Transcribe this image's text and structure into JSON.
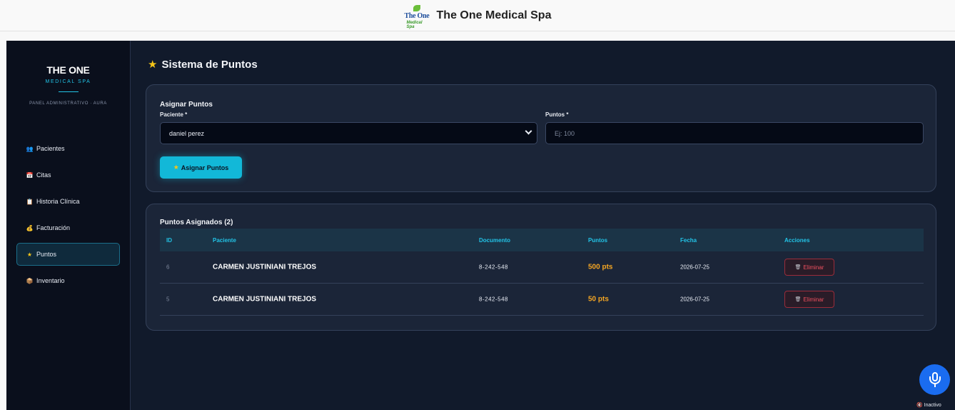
{
  "header": {
    "logo_text_top": "The One",
    "logo_text_bottom": "Medical Spa",
    "title": "The One Medical Spa"
  },
  "sidebar": {
    "brand_title": "THE ONE",
    "brand_sub": "MEDICAL SPA",
    "panel_label": "PANEL ADMINISTRATIVO · AURA",
    "items": [
      {
        "icon": "users-icon",
        "glyph": "👥",
        "label": "Pacientes"
      },
      {
        "icon": "calendar-icon",
        "glyph": "📅",
        "label": "Citas"
      },
      {
        "icon": "clipboard-icon",
        "glyph": "📋",
        "label": "Historia Clínica"
      },
      {
        "icon": "money-bag-icon",
        "glyph": "💰",
        "label": "Facturación"
      },
      {
        "icon": "star-icon",
        "glyph": "★",
        "label": "Puntos",
        "active": true
      },
      {
        "icon": "box-icon",
        "glyph": "📦",
        "label": "Inventario"
      }
    ]
  },
  "page": {
    "title": "Sistema de Puntos"
  },
  "assign_form": {
    "heading": "Asignar Puntos",
    "patient_label": "Paciente *",
    "patient_value": "daniel perez",
    "points_label": "Puntos *",
    "points_placeholder": "Ej: 100",
    "submit_label": "Asignar Puntos"
  },
  "points_table": {
    "heading": "Puntos Asignados (2)",
    "columns": [
      "ID",
      "Paciente",
      "Documento",
      "Puntos",
      "Fecha",
      "Acciones"
    ],
    "rows": [
      {
        "id": "6",
        "paciente": "CARMEN JUSTINIANI TREJOS",
        "documento": "8-242-548",
        "puntos": "500 pts",
        "fecha": "2026-07-25",
        "accion": "Eliminar"
      },
      {
        "id": "5",
        "paciente": "CARMEN JUSTINIANI TREJOS",
        "documento": "8-242-548",
        "puntos": "50 pts",
        "fecha": "2026-07-25",
        "accion": "Eliminar"
      }
    ]
  },
  "voice": {
    "status": "Inactivo"
  },
  "colors": {
    "accent": "#12b8d8",
    "points": "#f5a623",
    "danger": "#f0505f",
    "background": "#111a2b"
  }
}
